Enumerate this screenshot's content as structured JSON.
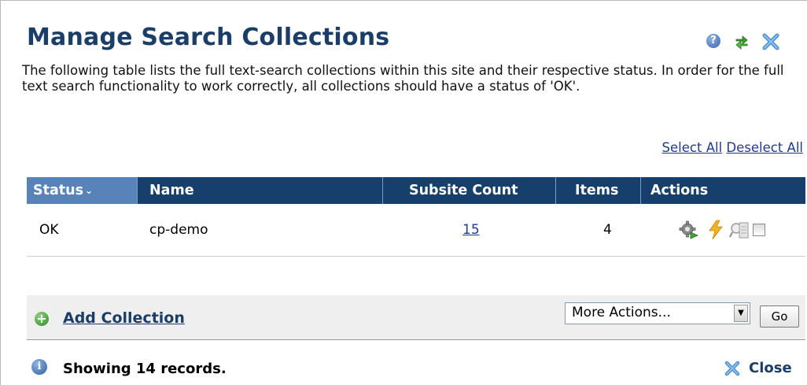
{
  "header": {
    "title": "Manage Search Collections",
    "description": "The following table lists the full text-search collections within this site and their respective status. In order for the full text search functionality to work correctly, all collections should have a status of 'OK'.",
    "icons": [
      "help-icon",
      "refresh-icon",
      "close-icon"
    ]
  },
  "selection": {
    "select_all": "Select All",
    "deselect_all": "Deselect All"
  },
  "table": {
    "columns": [
      "Status",
      "Name",
      "Subsite Count",
      "Items",
      "Actions"
    ],
    "sort_indicator": "⌄",
    "rows": [
      {
        "status": "OK",
        "name": "cp-demo",
        "subsite_count": "15",
        "items": "4",
        "actions": [
          "settings-icon",
          "rebuild-icon",
          "index-icon",
          "select-checkbox"
        ]
      }
    ]
  },
  "footer": {
    "add_label": "Add Collection",
    "more_actions": {
      "selected": "More Actions...",
      "options": [
        "More Actions..."
      ]
    },
    "go_label": "Go",
    "records_text": "Showing 14 records.",
    "close_label": "Close"
  },
  "colors": {
    "title": "#1a3e68",
    "header_bg": "#163f6b",
    "status_header_bg": "#5783b8",
    "link": "#223a8c",
    "footer_bg": "#efefef"
  }
}
